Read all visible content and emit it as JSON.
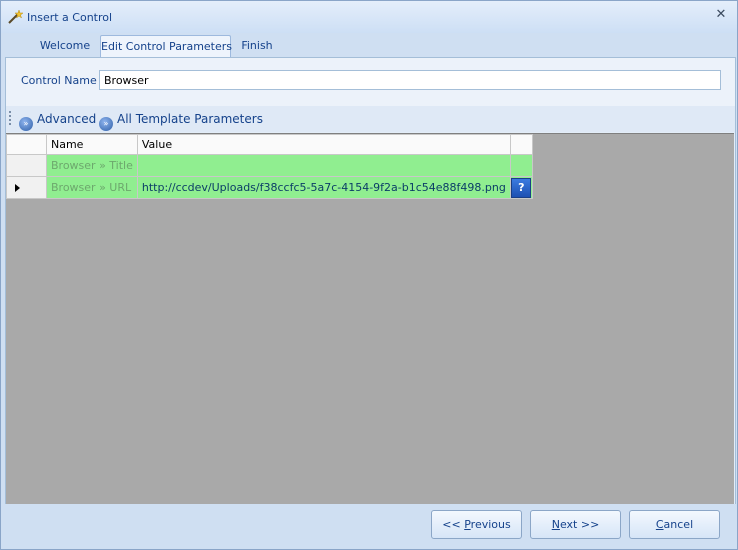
{
  "window": {
    "title": "Insert a Control",
    "close_glyph": "✕"
  },
  "tabs": [
    {
      "label": "Welcome",
      "active": false
    },
    {
      "label": "Edit Control Parameters",
      "active": true
    },
    {
      "label": "Finish",
      "active": false
    }
  ],
  "control_name": {
    "label": "Control Name",
    "value": "Browser"
  },
  "toolbar": {
    "advanced_label": "Advanced",
    "all_params_label": "All Template Parameters"
  },
  "grid": {
    "headers": {
      "name": "Name",
      "value": "Value"
    },
    "rows": [
      {
        "name": "Browser » Title",
        "value": "",
        "current": false
      },
      {
        "name": "Browser » URL",
        "value": "http://ccdev/Uploads/f38ccfc5-5a7c-4154-9f2a-b1c54e88f498.png",
        "current": true
      }
    ],
    "help_glyph": "?"
  },
  "buttons": {
    "previous_prefix": "<< ",
    "previous_mnemonic": "P",
    "previous_rest": "revious",
    "next_mnemonic": "N",
    "next_rest": "ext >>",
    "cancel_mnemonic": "C",
    "cancel_rest": "ancel"
  }
}
